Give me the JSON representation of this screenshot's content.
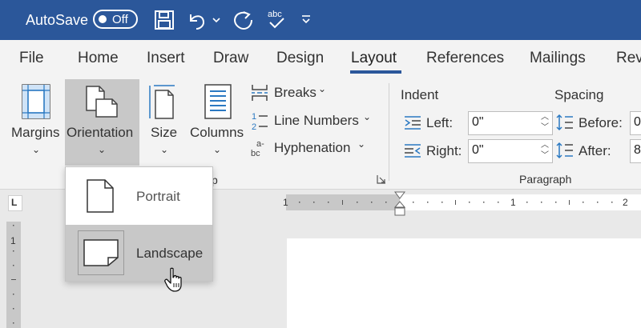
{
  "titlebar": {
    "autosave_label": "AutoSave",
    "toggle_label": "Off",
    "icons": [
      "save-icon",
      "undo-icon",
      "redo-icon",
      "spelling-icon",
      "customize-qat-icon"
    ],
    "color": "#2b579a"
  },
  "tabs": [
    "File",
    "Home",
    "Insert",
    "Draw",
    "Design",
    "Layout",
    "References",
    "Mailings",
    "Rev"
  ],
  "active_tab": "Layout",
  "ribbon": {
    "page_setup": {
      "margins": "Margins",
      "orientation": "Orientation",
      "size": "Size",
      "columns": "Columns",
      "breaks": "Breaks",
      "line_numbers": "Line Numbers",
      "hyphenation": "Hyphenation",
      "group_label_fragment": "p"
    },
    "indent": {
      "title": "Indent",
      "left_label": "Left:",
      "left_value": "0\"",
      "right_label": "Right:",
      "right_value": "0\""
    },
    "spacing": {
      "title": "Spacing",
      "before_label": "Before:",
      "before_value": "0",
      "after_label": "After:",
      "after_value": "8"
    },
    "paragraph_label": "Paragraph"
  },
  "ruler": {
    "corner": "L",
    "numbers": [
      "1",
      "1",
      "2"
    ],
    "vertical_number": "1"
  },
  "orientation_menu": {
    "portrait": "Portrait",
    "landscape": "Landscape",
    "hovered": "Landscape"
  }
}
